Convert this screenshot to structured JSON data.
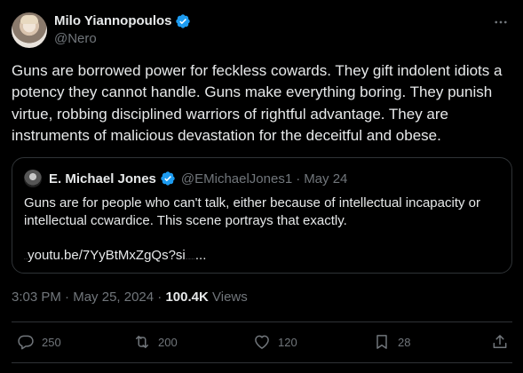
{
  "author": {
    "display_name": "Milo Yiannopoulos",
    "handle": "@Nero"
  },
  "tweet": {
    "text": "Guns are borrowed power for feckless cowards. They gift indolent idiots a potency they cannot handle. Guns make everything boring. They punish virtue, robbing disciplined warriors of rightful advantage. They are instruments of malicious devastation for the deceitful and obese."
  },
  "quote": {
    "display_name": "E. Michael Jones",
    "handle": "@EMichaelJones1",
    "separator": "·",
    "date": "May 24",
    "text": "Guns are for people who can't talk, either because of intellectual incapacity or intellectual ccwardice. This scene portrays that exactly.",
    "link_prefix": "...",
    "link": "youtu.be/7YyBtMxZgQs?si",
    "link_suffix": "...",
    "link_tiny_tail": "........"
  },
  "meta": {
    "time": "3:03 PM",
    "sep1": "·",
    "date": "May 25, 2024",
    "sep2": "·",
    "views_count": "100.4K",
    "views_label": "Views"
  },
  "actions": {
    "replies": "250",
    "reposts": "200",
    "likes": "120",
    "bookmarks": "28"
  },
  "icons": {
    "verified": "verified-badge-icon",
    "more": "more-icon",
    "reply": "reply-icon",
    "repost": "repost-icon",
    "like": "heart-icon",
    "bookmark": "bookmark-icon",
    "share": "share-icon"
  },
  "colors": {
    "background": "#000000",
    "text": "#e7e9ea",
    "secondary": "#71767b",
    "border": "#2f3336",
    "verified": "#1d9bf0"
  }
}
